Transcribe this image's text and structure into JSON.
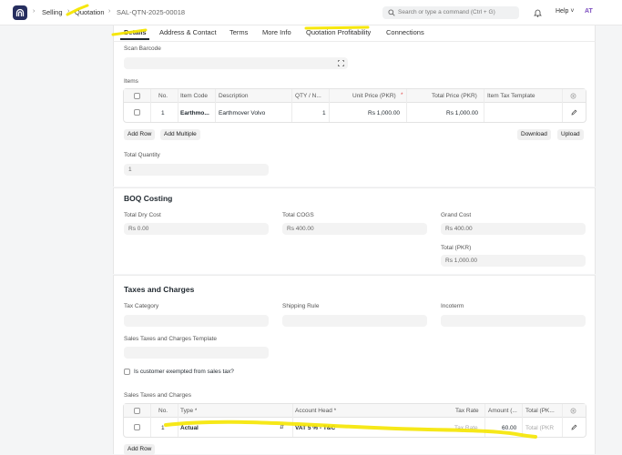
{
  "topbar": {
    "crumbs": [
      "Selling",
      "Quotation",
      "SAL-QTN-2025-00018"
    ],
    "search_placeholder": "Search or type a command (Ctrl + G)",
    "help_label": "Help",
    "avatar_initials": "AT"
  },
  "tabs": [
    "Details",
    "Address & Contact",
    "Terms",
    "More Info",
    "Quotation Profitability",
    "Connections"
  ],
  "items_section": {
    "scan_barcode_label": "Scan Barcode",
    "items_label": "Items",
    "columns": [
      "No.",
      "Item Code",
      "Description",
      "QTY / N...",
      "Unit Price (PKR)",
      "Total Price (PKR)",
      "Item Tax Template"
    ],
    "row": {
      "no": "1",
      "item_code": "Earthmo...",
      "description": "Earthmover Volvo",
      "qty": "1",
      "unit_price": "Rs 1,000.00",
      "total_price": "Rs 1,000.00",
      "item_tax_template": ""
    },
    "buttons": [
      "Add Row",
      "Add Multiple",
      "Download",
      "Upload"
    ],
    "total_quantity_label": "Total Quantity",
    "total_quantity_value": "1"
  },
  "boq": {
    "title": "BOQ Costing",
    "total_dry_cost_label": "Total Dry Cost",
    "total_dry_cost_value": "Rs 0.00",
    "total_cogs_label": "Total COGS",
    "total_cogs_value": "Rs 400.00",
    "grand_cost_label": "Grand Cost",
    "grand_cost_value": "Rs 400.00",
    "total_pkr_label": "Total (PKR)",
    "total_pkr_value": "Rs 1,000.00"
  },
  "taxes": {
    "title": "Taxes and Charges",
    "tax_category_label": "Tax Category",
    "shipping_rule_label": "Shipping Rule",
    "incoterm_label": "Incoterm",
    "template_label": "Sales Taxes and Charges Template",
    "exempt_label": "Is customer exempted from sales tax?",
    "table_label": "Sales Taxes and Charges",
    "columns": [
      "No.",
      "Type *",
      "Account Head *",
      "Tax Rate",
      "Amount (...",
      "Total (PK..."
    ],
    "row": {
      "no": "1",
      "type": "Actual",
      "account_head": "VAT 5 % - T&C",
      "tax_rate_placeholder": "Tax Rate",
      "amount": "60.00",
      "total_placeholder": "Total (PKR"
    },
    "add_row_label": "Add Row"
  },
  "colors": {
    "highlight": "#f5e600",
    "logo": "#262e5f",
    "avatar": "#7c4dbf"
  }
}
